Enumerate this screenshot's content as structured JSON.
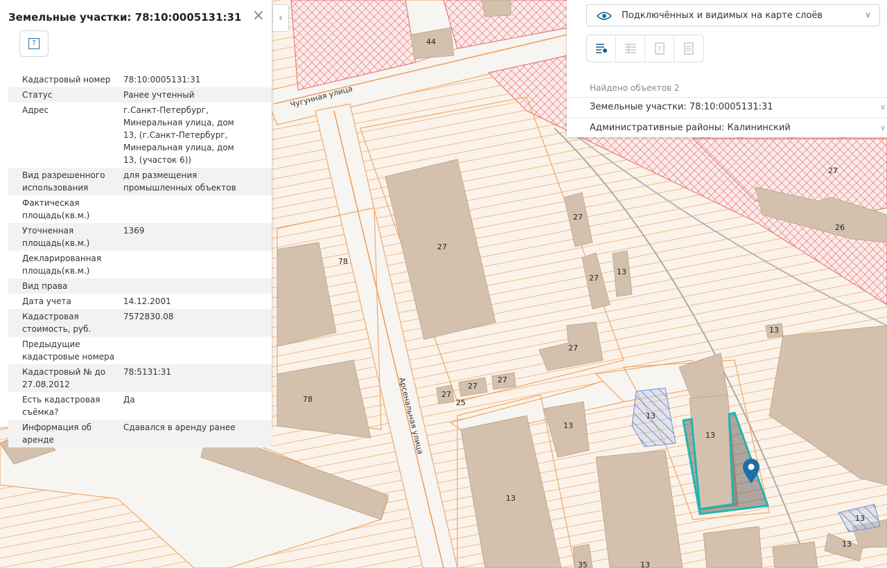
{
  "info_panel": {
    "title": "Земельные участки: 78:10:0005131:31",
    "close_icon": "×",
    "contour_icon": "?",
    "attributes": [
      {
        "key": "Кадастровый номер",
        "value": "78:10:0005131:31"
      },
      {
        "key": "Статус",
        "value": "Ранее учтенный"
      },
      {
        "key": "Адрес",
        "value": "г.Санкт-Петербург, Минеральная улица, дом 13, (г.Санкт-Петербург, Минеральная улица, дом 13, (участок 6))"
      },
      {
        "key": "Вид разрешенного использования",
        "value": "для размещения промышленных объектов"
      },
      {
        "key": "Фактическая площадь(кв.м.)",
        "value": ""
      },
      {
        "key": "Уточненная площадь(кв.м.)",
        "value": "1369"
      },
      {
        "key": "Декларированная площадь(кв.м.)",
        "value": ""
      },
      {
        "key": "Вид права",
        "value": ""
      },
      {
        "key": "Дата учета",
        "value": "14.12.2001"
      },
      {
        "key": "Кадастровая стоимость, руб.",
        "value": "7572830.08"
      },
      {
        "key": "Предыдущие кадастровые номера",
        "value": ""
      },
      {
        "key": "Кадастровый № до 27.08.2012",
        "value": "78:5131:31"
      },
      {
        "key": "Есть кадастровая съёмка?",
        "value": "Да"
      },
      {
        "key": "Информация об аренде",
        "value": "Сдавался в аренду ранее"
      }
    ]
  },
  "collapse_icon": "‹",
  "layers_panel": {
    "select_text": "Подключённых и видимых на карте слоёв",
    "found_text": "Найдено объектов 2",
    "found_items": [
      {
        "label": "Земельные участки: 78:10:0005131:31"
      },
      {
        "label": "Административные районы: Калининский"
      }
    ]
  },
  "map": {
    "street_labels": [
      "Чугунная улица",
      "Арсенальная улица"
    ],
    "building_numbers": [
      "44",
      "27",
      "27",
      "27",
      "13",
      "27",
      "27",
      "27",
      "27",
      "27",
      "25",
      "13",
      "13",
      "13",
      "13",
      "13",
      "13",
      "13",
      "78",
      "78",
      "26",
      "13",
      "35"
    ],
    "colors": {
      "parcel_line": "#f0a765",
      "building": "#d4c1ad",
      "restricted": "#e87b7b",
      "selected": "#1fb5b0",
      "pin": "#1d6fa5"
    }
  }
}
